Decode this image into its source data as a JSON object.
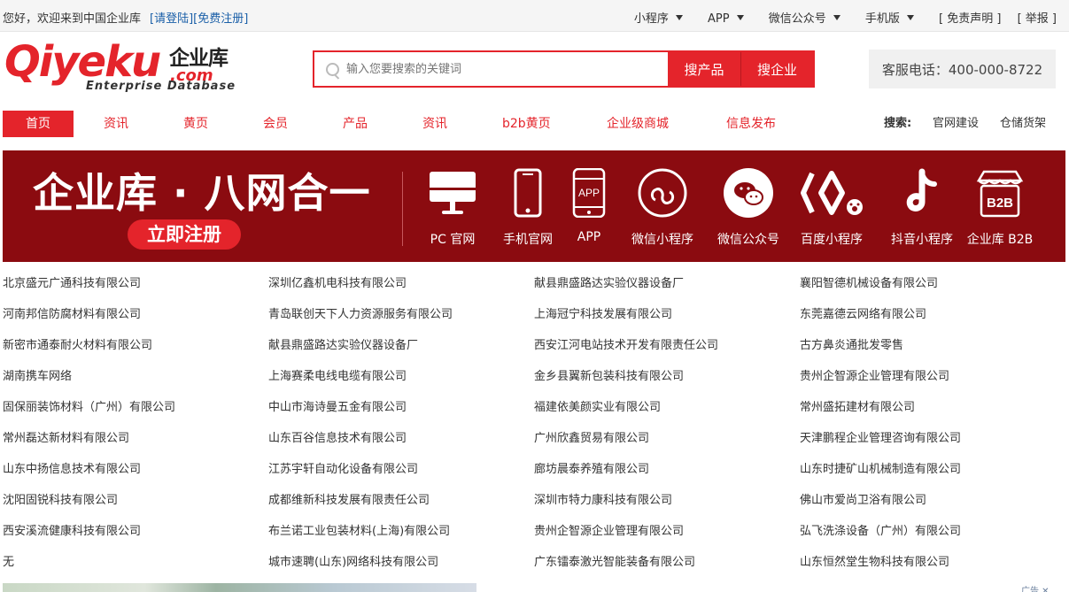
{
  "topbar": {
    "welcome": "您好，欢迎来到中国企业库",
    "login": "[请登陆]",
    "register": "[免费注册]",
    "miniprogram": "小程序",
    "app": "APP",
    "wechat": "微信公众号",
    "mobile": "手机版",
    "disclaimer": "[ 免责声明 ]",
    "report": "[ 举报 ]"
  },
  "logo": {
    "main": "Qiyeku",
    "cn": "企业库",
    "com": ".com",
    "sub": "Enterprise Database"
  },
  "search": {
    "placeholder": "输入您要搜索的关键词",
    "btn_product": "搜产品",
    "btn_company": "搜企业"
  },
  "hotline": "客服电话：400-000-8722",
  "nav": {
    "items": [
      "首页",
      "资讯",
      "黄页",
      "会员",
      "产品",
      "资讯",
      "b2b黄页",
      "企业级商城",
      "信息发布"
    ],
    "search_label": "搜索:",
    "keywords": [
      "官网建设",
      "仓储货架"
    ]
  },
  "banner": {
    "slogan": "企业库 · 八网合一",
    "register": "立即注册",
    "app_badge": "APP",
    "b2b_badge": "B2B",
    "features": [
      "PC 官网",
      "手机官网",
      "APP",
      "微信小程序",
      "微信公众号",
      "百度小程序",
      "抖音小程序",
      "企业库 B2B"
    ]
  },
  "companies": [
    [
      "北京盛元广通科技有限公司",
      "深圳亿鑫机电科技有限公司",
      "献县鼎盛路达实验仪器设备厂",
      "襄阳智德机械设备有限公司"
    ],
    [
      "河南邦信防腐材料有限公司",
      "青岛联创天下人力资源服务有限公司",
      "上海冠宁科技发展有限公司",
      "东莞嘉德云网络有限公司"
    ],
    [
      "新密市通泰耐火材料有限公司",
      "献县鼎盛路达实验仪器设备厂",
      "西安江河电站技术开发有限责任公司",
      "古方鼻炎通批发零售"
    ],
    [
      "湖南携车网络",
      "上海赛柔电线电缆有限公司",
      "金乡县翼新包装科技有限公司",
      "贵州企智源企业管理有限公司"
    ],
    [
      "固保丽装饰材料（广州）有限公司",
      "中山市海诗曼五金有限公司",
      "福建依美颜实业有限公司",
      "常州盛拓建材有限公司"
    ],
    [
      "常州磊达新材料有限公司",
      "山东百谷信息技术有限公司",
      "广州欣鑫贸易有限公司",
      "天津鹏程企业管理咨询有限公司"
    ],
    [
      "山东中扬信息技术有限公司",
      "江苏宇轩自动化设备有限公司",
      "廊坊晨泰养殖有限公司",
      "山东时捷矿山机械制造有限公司"
    ],
    [
      "沈阳固锐科技有限公司",
      "成都维新科技发展有限责任公司",
      "深圳市特力康科技有限公司",
      "佛山市爱尚卫浴有限公司"
    ],
    [
      "西安溪流健康科技有限公司",
      "布兰诺工业包装材料(上海)有限公司",
      "贵州企智源企业管理有限公司",
      "弘飞洗涤设备（广州）有限公司"
    ],
    [
      "无",
      "城市速聘(山东)网络科技有限公司",
      "广东镭泰激光智能装备有限公司",
      "山东恒然堂生物科技有限公司"
    ]
  ],
  "ad_tag": "广告 ✕",
  "colors": {
    "brand": "#e4242b",
    "banner_bg": "#8b0b10"
  }
}
